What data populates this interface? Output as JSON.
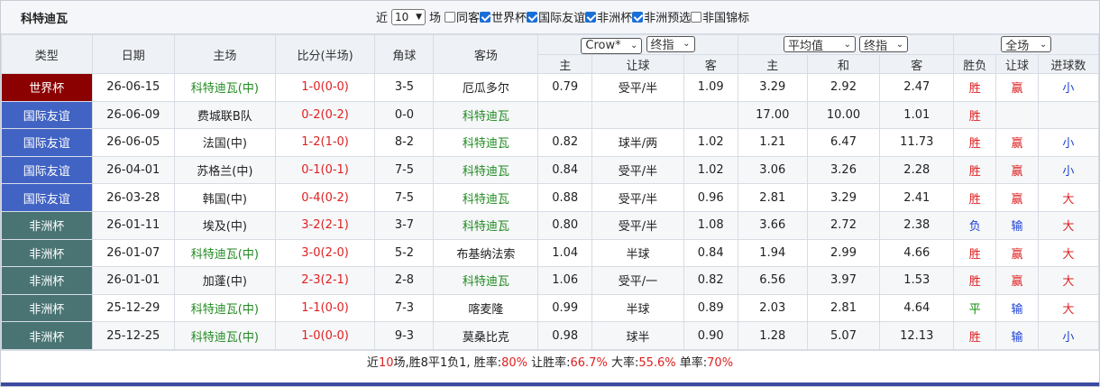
{
  "header": {
    "team_title": "科特迪瓦",
    "near_label": "近",
    "count_value": "10",
    "count_suffix": "场",
    "filters": [
      {
        "label": "同客",
        "checked": false
      },
      {
        "label": "世界杯",
        "checked": true
      },
      {
        "label": "国际友谊",
        "checked": true
      },
      {
        "label": "非洲杯",
        "checked": true
      },
      {
        "label": "非洲预选",
        "checked": true
      },
      {
        "label": "非国锦标",
        "checked": false
      }
    ]
  },
  "columns": {
    "type": "类型",
    "date": "日期",
    "home": "主场",
    "score": "比分(半场)",
    "corner": "角球",
    "away": "客场",
    "company_select": "Crow*",
    "odds_select": "终指",
    "avg_select": "平均值",
    "avg_odds_select": "终指",
    "range_select": "全场",
    "sub_home": "主",
    "sub_handicap": "让球",
    "sub_away": "客",
    "sub_home2": "主",
    "sub_draw": "和",
    "sub_away2": "客",
    "sub_result": "胜负",
    "sub_ah": "让球",
    "sub_goals": "进球数"
  },
  "rows": [
    {
      "league": "世界杯",
      "league_color": "#8b0000",
      "date": "26-06-15",
      "home": "科特迪瓦(中)",
      "home_is_team": true,
      "score": "1-0",
      "half": "(0-0)",
      "corner": "3-5",
      "away": "厄瓜多尔",
      "away_is_team": false,
      "o_home": "0.79",
      "o_hcp": "受平/半",
      "o_away": "1.09",
      "a_home": "3.29",
      "a_draw": "2.92",
      "a_away": "2.47",
      "result": "胜",
      "ah": "赢",
      "goals": "小"
    },
    {
      "league": "国际友谊",
      "league_color": "#4163c4",
      "date": "26-06-09",
      "home": "费城联B队",
      "home_is_team": false,
      "score": "0-2",
      "half": "(0-2)",
      "corner": "0-0",
      "away": "科特迪瓦",
      "away_is_team": true,
      "o_home": "",
      "o_hcp": "",
      "o_away": "",
      "a_home": "17.00",
      "a_draw": "10.00",
      "a_away": "1.01",
      "result": "胜",
      "ah": "",
      "goals": ""
    },
    {
      "league": "国际友谊",
      "league_color": "#4163c4",
      "date": "26-06-05",
      "home": "法国(中)",
      "home_is_team": false,
      "score": "1-2",
      "half": "(1-0)",
      "corner": "8-2",
      "away": "科特迪瓦",
      "away_is_team": true,
      "o_home": "0.82",
      "o_hcp": "球半/两",
      "o_away": "1.02",
      "a_home": "1.21",
      "a_draw": "6.47",
      "a_away": "11.73",
      "result": "胜",
      "ah": "赢",
      "goals": "小"
    },
    {
      "league": "国际友谊",
      "league_color": "#4163c4",
      "date": "26-04-01",
      "home": "苏格兰(中)",
      "home_is_team": false,
      "score": "0-1",
      "half": "(0-1)",
      "corner": "7-5",
      "away": "科特迪瓦",
      "away_is_team": true,
      "o_home": "0.84",
      "o_hcp": "受平/半",
      "o_away": "1.02",
      "a_home": "3.06",
      "a_draw": "3.26",
      "a_away": "2.28",
      "result": "胜",
      "ah": "赢",
      "goals": "小"
    },
    {
      "league": "国际友谊",
      "league_color": "#4163c4",
      "date": "26-03-28",
      "home": "韩国(中)",
      "home_is_team": false,
      "score": "0-4",
      "half": "(0-2)",
      "corner": "7-5",
      "away": "科特迪瓦",
      "away_is_team": true,
      "o_home": "0.88",
      "o_hcp": "受平/半",
      "o_away": "0.96",
      "a_home": "2.81",
      "a_draw": "3.29",
      "a_away": "2.41",
      "result": "胜",
      "ah": "赢",
      "goals": "大"
    },
    {
      "league": "非洲杯",
      "league_color": "#4a7474",
      "date": "26-01-11",
      "home": "埃及(中)",
      "home_is_team": false,
      "score": "3-2",
      "half": "(2-1)",
      "corner": "3-7",
      "away": "科特迪瓦",
      "away_is_team": true,
      "o_home": "0.80",
      "o_hcp": "受平/半",
      "o_away": "1.08",
      "a_home": "3.66",
      "a_draw": "2.72",
      "a_away": "2.38",
      "result": "负",
      "ah": "输",
      "goals": "大"
    },
    {
      "league": "非洲杯",
      "league_color": "#4a7474",
      "date": "26-01-07",
      "home": "科特迪瓦(中)",
      "home_is_team": true,
      "score": "3-0",
      "half": "(2-0)",
      "corner": "5-2",
      "away": "布基纳法索",
      "away_is_team": false,
      "o_home": "1.04",
      "o_hcp": "半球",
      "o_away": "0.84",
      "a_home": "1.94",
      "a_draw": "2.99",
      "a_away": "4.66",
      "result": "胜",
      "ah": "赢",
      "goals": "大"
    },
    {
      "league": "非洲杯",
      "league_color": "#4a7474",
      "date": "26-01-01",
      "home": "加蓬(中)",
      "home_is_team": false,
      "score": "2-3",
      "half": "(2-1)",
      "corner": "2-8",
      "away": "科特迪瓦",
      "away_is_team": true,
      "o_home": "1.06",
      "o_hcp": "受平/一",
      "o_away": "0.82",
      "a_home": "6.56",
      "a_draw": "3.97",
      "a_away": "1.53",
      "result": "胜",
      "ah": "赢",
      "goals": "大"
    },
    {
      "league": "非洲杯",
      "league_color": "#4a7474",
      "date": "25-12-29",
      "home": "科特迪瓦(中)",
      "home_is_team": true,
      "score": "1-1",
      "half": "(0-0)",
      "corner": "7-3",
      "away": "喀麦隆",
      "away_is_team": false,
      "o_home": "0.99",
      "o_hcp": "半球",
      "o_away": "0.89",
      "a_home": "2.03",
      "a_draw": "2.81",
      "a_away": "4.64",
      "result": "平",
      "ah": "输",
      "goals": "大"
    },
    {
      "league": "非洲杯",
      "league_color": "#4a7474",
      "date": "25-12-25",
      "home": "科特迪瓦(中)",
      "home_is_team": true,
      "score": "1-0",
      "half": "(0-0)",
      "corner": "9-3",
      "away": "莫桑比克",
      "away_is_team": false,
      "o_home": "0.98",
      "o_hcp": "球半",
      "o_away": "0.90",
      "a_home": "1.28",
      "a_draw": "5.07",
      "a_away": "12.13",
      "result": "胜",
      "ah": "输",
      "goals": "小"
    }
  ],
  "summary": {
    "prefix": "近",
    "count": "10",
    "mid": "场,胜8平1负1, 胜率:",
    "win_rate": "80%",
    "ah_label": " 让胜率:",
    "ah_rate": "66.7%",
    "big_label": " 大率:",
    "big_rate": "55.6%",
    "odd_label": " 单率:",
    "odd_rate": "70%"
  },
  "colors": {
    "win": "#e02020",
    "draw": "#0c8a0c",
    "loss": "#1a3fd6",
    "team": "#1f8a1f"
  }
}
